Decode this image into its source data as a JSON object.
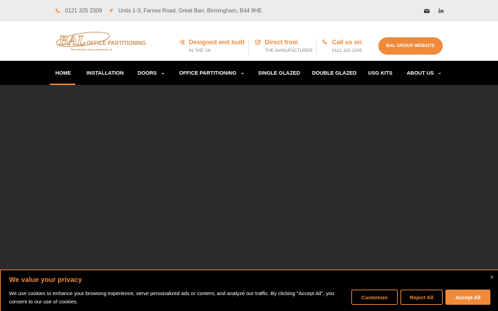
{
  "topbar": {
    "phone": "0121 325 2309",
    "address": "Units 1-3, Farrow Road, Great Barr, Birmingham, B44 9HE",
    "phone_icon": "phone-icon",
    "address_icon": "location-arrow-icon",
    "social": [
      "envelope-icon",
      "linkedin-icon"
    ]
  },
  "header": {
    "logo": {
      "main": "BAL",
      "sub": "OFFICE PARTITIONING",
      "tagline": "Part of the BAL Group (Aluminium) Ltd"
    },
    "features": [
      {
        "icon": "cogs-icon",
        "title": "Designed and built",
        "subtitle": "IN THE UK"
      },
      {
        "icon": "check-square-icon",
        "title": "Direct from",
        "subtitle": "THE MANUFACTURER"
      },
      {
        "icon": "phone-icon",
        "title": "Call us on",
        "subtitle": "0121 325 2309"
      }
    ],
    "cta": "BAL GROUP WEBSITE"
  },
  "nav": {
    "items": [
      {
        "label": "HOME",
        "active": true
      },
      {
        "label": "INSTALLATION"
      },
      {
        "label": "DOORS",
        "dropdown": true
      },
      {
        "label": "OFFICE PARTITIONING",
        "dropdown": true
      },
      {
        "label": "SINGLE GLAZED"
      },
      {
        "label": "DOUBLE GLAZED"
      },
      {
        "label": "USG KITS"
      },
      {
        "label": "ABOUT US",
        "dropdown": true
      }
    ]
  },
  "cookie": {
    "title": "We value your privacy",
    "body": "We use cookies to enhance your browsing experience, serve personalized ads or content, and analyze our traffic. By clicking \"Accept All\", you consent to our use of cookies.",
    "customize": "Customize",
    "reject": "Reject All",
    "accept": "Accept All",
    "close": "×"
  },
  "colors": {
    "accent": "#ef8a3a",
    "nav_bg": "#000000",
    "hero_bg": "#2b2b2b",
    "topbar_bg": "#ececec"
  }
}
